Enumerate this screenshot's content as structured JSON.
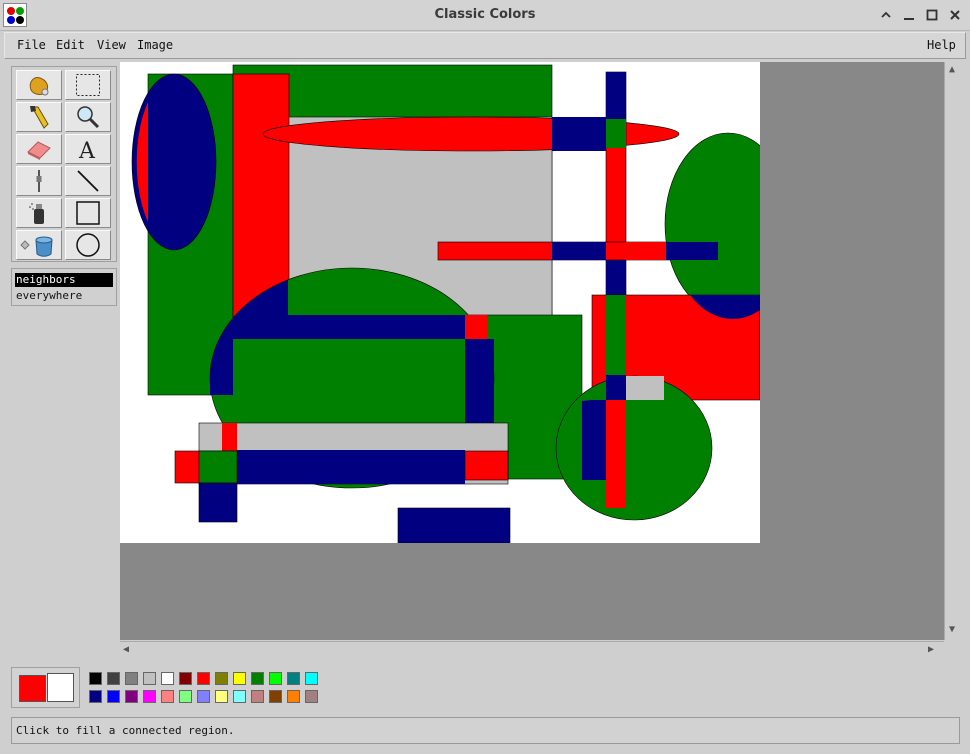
{
  "window": {
    "title": "Classic Colors",
    "controls": [
      "minimize-to-shade",
      "minimize",
      "maximize",
      "close"
    ]
  },
  "menu": {
    "left": [
      "File",
      "Edit",
      "View",
      "Image"
    ],
    "right": "Help"
  },
  "tools": [
    [
      "free-form-select",
      "select-rectangle"
    ],
    [
      "pick-color",
      "magnifier"
    ],
    [
      "eraser",
      "text"
    ],
    [
      "pencil",
      "line"
    ],
    [
      "airbrush",
      "rectangle"
    ],
    [
      "fill-bucket",
      "ellipse"
    ]
  ],
  "fill_modes": {
    "options": [
      "neighbors",
      "everywhere"
    ],
    "selected": "neighbors"
  },
  "colors": {
    "foreground": "#ff0000",
    "background": "#ffffff",
    "palette_row1": [
      "#000000",
      "#404040",
      "#808080",
      "#c0c0c0",
      "#ffffff",
      "#800000",
      "#ff0000",
      "#808000",
      "#ffff00",
      "#008000",
      "#00ff00",
      "#008080",
      "#00ffff"
    ],
    "palette_row2": [
      "#000080",
      "#0000ff",
      "#800080",
      "#ff00ff",
      "#ff8080",
      "#80ff80",
      "#8080ff",
      "#ffff80",
      "#80ffff",
      "#c08080",
      "#804000",
      "#ff8000",
      "#a08080"
    ]
  },
  "status": {
    "text": "Click to fill a connected region."
  }
}
